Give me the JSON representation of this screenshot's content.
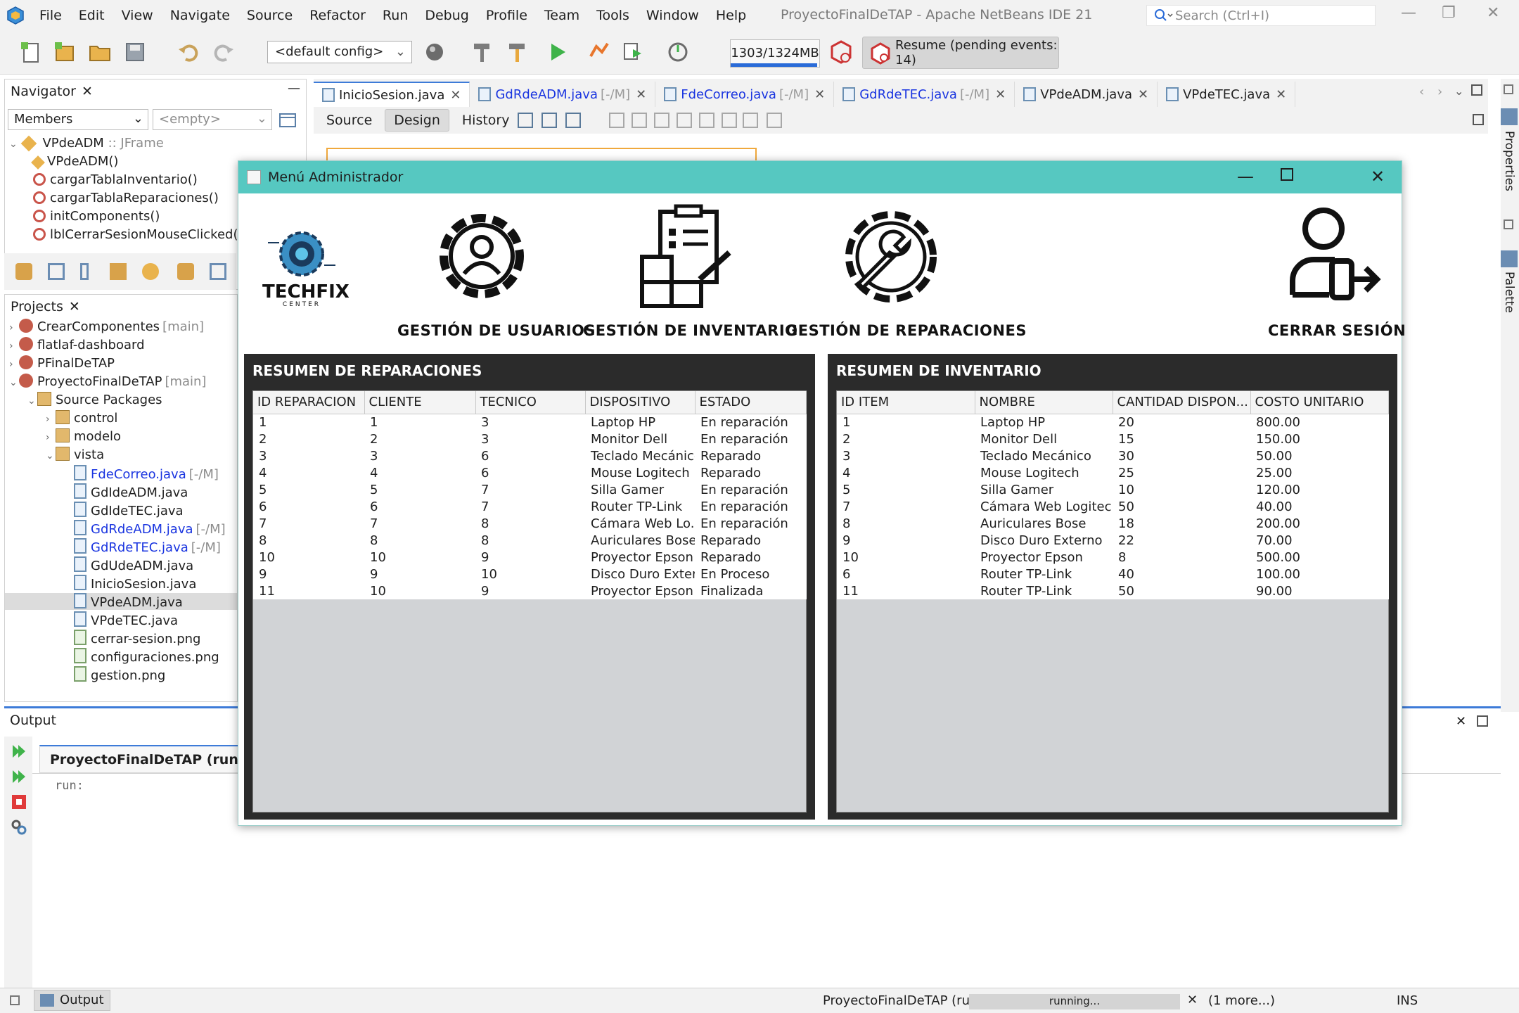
{
  "menubar": {
    "items": [
      "File",
      "Edit",
      "View",
      "Navigate",
      "Source",
      "Refactor",
      "Run",
      "Debug",
      "Profile",
      "Team",
      "Tools",
      "Window",
      "Help"
    ],
    "window_title": "ProyectoFinalDeTAP - Apache NetBeans IDE 21",
    "search_placeholder": "Search (Ctrl+I)"
  },
  "toolbar": {
    "config": "<default config>",
    "memory": "1303/1324MB",
    "memory_fraction": 0.98,
    "resume": "Resume (pending events: 14)"
  },
  "navigator": {
    "title": "Navigator",
    "filter": "Members",
    "empty": "<empty>",
    "root": "VPdeADM",
    "root_type": ":: JFrame",
    "members": [
      "VPdeADM()",
      "cargarTablaInventario()",
      "cargarTablaReparaciones()",
      "initComponents()",
      "lblCerrarSesionMouseClicked(M"
    ]
  },
  "projects": {
    "title": "Projects",
    "items": [
      {
        "label": "CrearComponentes",
        "suffix": "[main]"
      },
      {
        "label": "flatlaf-dashboard",
        "suffix": ""
      },
      {
        "label": "PFinalDeTAP",
        "suffix": ""
      },
      {
        "label": "ProyectoFinalDeTAP",
        "suffix": "[main]"
      },
      {
        "label": "Source Packages",
        "suffix": ""
      },
      {
        "label": "control",
        "suffix": ""
      },
      {
        "label": "modelo",
        "suffix": ""
      },
      {
        "label": "vista",
        "suffix": ""
      },
      {
        "label": "FdeCorreo.java",
        "suffix": "[-/M]"
      },
      {
        "label": "GdIdeADM.java",
        "suffix": ""
      },
      {
        "label": "GdIdeTEC.java",
        "suffix": ""
      },
      {
        "label": "GdRdeADM.java",
        "suffix": "[-/M]"
      },
      {
        "label": "GdRdeTEC.java",
        "suffix": "[-/M]"
      },
      {
        "label": "GdUdeADM.java",
        "suffix": ""
      },
      {
        "label": "InicioSesion.java",
        "suffix": ""
      },
      {
        "label": "VPdeADM.java",
        "suffix": ""
      },
      {
        "label": "VPdeTEC.java",
        "suffix": ""
      },
      {
        "label": "cerrar-sesion.png",
        "suffix": ""
      },
      {
        "label": "configuraciones.png",
        "suffix": ""
      },
      {
        "label": "gestion.png",
        "suffix": ""
      }
    ]
  },
  "editor": {
    "tabs": [
      {
        "label": "InicioSesion.java",
        "suffix": ""
      },
      {
        "label": "GdRdeADM.java",
        "suffix": "[-/M]"
      },
      {
        "label": "FdeCorreo.java",
        "suffix": "[-/M]"
      },
      {
        "label": "GdRdeTEC.java",
        "suffix": "[-/M]"
      },
      {
        "label": "VPdeADM.java",
        "suffix": ""
      },
      {
        "label": "VPdeTEC.java",
        "suffix": ""
      }
    ],
    "modes": [
      "Source",
      "Design",
      "History"
    ]
  },
  "jframe": {
    "title": "Menú Administrador",
    "logo_text": "TECHFIX",
    "logo_sub": "CENTER",
    "menu": {
      "usuarios": "GESTIÓN DE USUARIOS",
      "inventario": "GESTIÓN DE INVENTARIO",
      "reparaciones": "GESTIÓN DE REPARACIONES",
      "cerrar": "CERRAR SESIÓN"
    },
    "reparaciones": {
      "title": "RESUMEN DE REPARACIONES",
      "columns": [
        "ID REPARACION",
        "CLIENTE",
        "TECNICO",
        "DISPOSITIVO",
        "ESTADO"
      ],
      "rows": [
        [
          "1",
          "1",
          "3",
          "Laptop HP",
          "En reparación"
        ],
        [
          "2",
          "2",
          "3",
          "Monitor Dell",
          "En reparación"
        ],
        [
          "3",
          "3",
          "6",
          "Teclado Mecánico",
          "Reparado"
        ],
        [
          "4",
          "4",
          "6",
          "Mouse Logitech",
          "Reparado"
        ],
        [
          "5",
          "5",
          "7",
          "Silla Gamer",
          "En reparación"
        ],
        [
          "6",
          "6",
          "7",
          "Router TP-Link",
          "En reparación"
        ],
        [
          "7",
          "7",
          "8",
          "Cámara Web Lo...",
          "En reparación"
        ],
        [
          "8",
          "8",
          "8",
          "Auriculares Bose",
          "Reparado"
        ],
        [
          "10",
          "10",
          "9",
          "Proyector Epson",
          "Reparado"
        ],
        [
          "9",
          "9",
          "10",
          "Disco Duro Exter...",
          "En Proceso"
        ],
        [
          "11",
          "10",
          "9",
          "Proyector Epson",
          "Finalizada"
        ]
      ]
    },
    "inventario": {
      "title": "RESUMEN DE INVENTARIO",
      "columns": [
        "ID ITEM",
        "NOMBRE",
        "CANTIDAD DISPON...",
        "COSTO UNITARIO"
      ],
      "rows": [
        [
          "1",
          "Laptop HP",
          "20",
          "800.00"
        ],
        [
          "2",
          "Monitor Dell",
          "15",
          "150.00"
        ],
        [
          "3",
          "Teclado Mecánico",
          "30",
          "50.00"
        ],
        [
          "4",
          "Mouse Logitech",
          "25",
          "25.00"
        ],
        [
          "5",
          "Silla Gamer",
          "10",
          "120.00"
        ],
        [
          "7",
          "Cámara Web Logitech",
          "50",
          "40.00"
        ],
        [
          "8",
          "Auriculares Bose",
          "18",
          "200.00"
        ],
        [
          "9",
          "Disco Duro Externo",
          "22",
          "70.00"
        ],
        [
          "10",
          "Proyector Epson",
          "8",
          "500.00"
        ],
        [
          "6",
          "Router TP-Link",
          "40",
          "100.00"
        ],
        [
          "11",
          "Router TP-Link",
          "50",
          "90.00"
        ]
      ]
    }
  },
  "output": {
    "title": "Output",
    "tab": "ProyectoFinalDeTAP (run)",
    "text": "run:"
  },
  "right_strip": {
    "properties": "Properties",
    "palette": "Palette"
  },
  "status": {
    "output_button": "Output",
    "task": "ProyectoFinalDeTAP (run)",
    "progress": "running...",
    "more": "(1 more...)",
    "mode": "INS"
  },
  "colors": {
    "accent": "#3d7bd8",
    "jframe_title": "#56c8c1",
    "summary_bg": "#2b2b2b",
    "link_blue": "#1a35e0"
  }
}
